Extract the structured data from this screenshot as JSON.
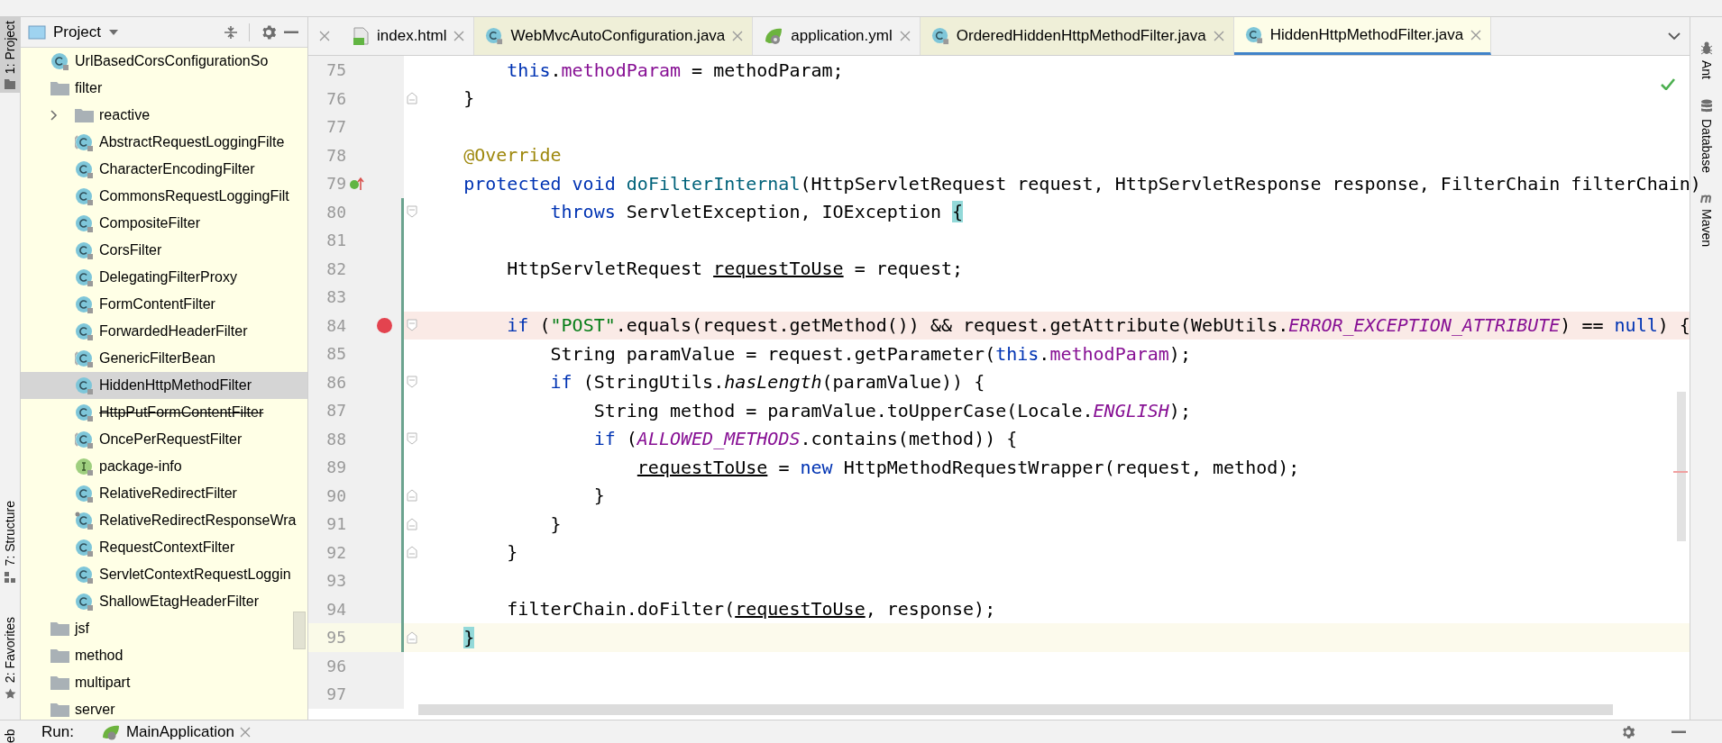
{
  "left_tool_strip": [
    {
      "label": "1: Project",
      "kind": "folder",
      "selected": true
    },
    {
      "label": "7: Structure",
      "kind": "structure",
      "selected": false
    },
    {
      "label": "2: Favorites",
      "kind": "favorites",
      "selected": false
    }
  ],
  "project": {
    "title": "Project",
    "tree": [
      {
        "label": "UrlBasedCorsConfigurationSo",
        "kind": "class",
        "selected": false,
        "deprecated": false
      },
      {
        "label": "filter",
        "kind": "folder",
        "selected": false,
        "deprecated": false,
        "children": [
          {
            "label": "reactive",
            "kind": "folder",
            "selected": false,
            "deprecated": false,
            "expanded": false
          },
          {
            "label": "AbstractRequestLoggingFilte",
            "kind": "abstract_class",
            "selected": false,
            "deprecated": false
          },
          {
            "label": "CharacterEncodingFilter",
            "kind": "class",
            "selected": false,
            "deprecated": false
          },
          {
            "label": "CommonsRequestLoggingFilt",
            "kind": "class",
            "selected": false,
            "deprecated": false
          },
          {
            "label": "CompositeFilter",
            "kind": "class",
            "selected": false,
            "deprecated": false
          },
          {
            "label": "CorsFilter",
            "kind": "class",
            "selected": false,
            "deprecated": false
          },
          {
            "label": "DelegatingFilterProxy",
            "kind": "class",
            "selected": false,
            "deprecated": false
          },
          {
            "label": "FormContentFilter",
            "kind": "class",
            "selected": false,
            "deprecated": false
          },
          {
            "label": "ForwardedHeaderFilter",
            "kind": "class",
            "selected": false,
            "deprecated": false
          },
          {
            "label": "GenericFilterBean",
            "kind": "abstract_class",
            "selected": false,
            "deprecated": false
          },
          {
            "label": "HiddenHttpMethodFilter",
            "kind": "class",
            "selected": true,
            "deprecated": false
          },
          {
            "label": "HttpPutFormContentFilter",
            "kind": "class",
            "selected": false,
            "deprecated": true
          },
          {
            "label": "OncePerRequestFilter",
            "kind": "abstract_class",
            "selected": false,
            "deprecated": false
          },
          {
            "label": "package-info",
            "kind": "info",
            "selected": false,
            "deprecated": false
          },
          {
            "label": "RelativeRedirectFilter",
            "kind": "class",
            "selected": false,
            "deprecated": false
          },
          {
            "label": "RelativeRedirectResponseWra",
            "kind": "inner_class",
            "selected": false,
            "deprecated": false
          },
          {
            "label": "RequestContextFilter",
            "kind": "class",
            "selected": false,
            "deprecated": false
          },
          {
            "label": "ServletContextRequestLoggin",
            "kind": "class",
            "selected": false,
            "deprecated": false
          },
          {
            "label": "ShallowEtagHeaderFilter",
            "kind": "class",
            "selected": false,
            "deprecated": false
          }
        ]
      },
      {
        "label": "jsf",
        "kind": "folder",
        "selected": false,
        "deprecated": false
      },
      {
        "label": "method",
        "kind": "folder",
        "selected": false,
        "deprecated": false
      },
      {
        "label": "multipart",
        "kind": "folder",
        "selected": false,
        "deprecated": false
      },
      {
        "label": "server",
        "kind": "folder",
        "selected": false,
        "deprecated": false
      }
    ]
  },
  "tabs": [
    {
      "label": "index.html",
      "kind": "html",
      "library": false,
      "selected": false
    },
    {
      "label": "WebMvcAutoConfiguration.java",
      "kind": "class",
      "library": true,
      "selected": false
    },
    {
      "label": "application.yml",
      "kind": "spring",
      "library": false,
      "selected": false
    },
    {
      "label": "OrderedHiddenHttpMethodFilter.java",
      "kind": "class",
      "library": true,
      "selected": false
    },
    {
      "label": "HiddenHttpMethodFilter.java",
      "kind": "class",
      "library": true,
      "selected": true
    }
  ],
  "editor": {
    "lines": [
      {
        "number": "75",
        "kind": "plain",
        "breakpoint": false,
        "changed": false,
        "current": false,
        "tokens": [
          {
            "text": "        this",
            "kind": "keyword"
          },
          {
            "text": ".",
            "kind": "plain"
          },
          {
            "text": "methodParam",
            "kind": "field"
          },
          {
            "text": " = methodParam;",
            "kind": "plain"
          }
        ]
      },
      {
        "number": "76",
        "kind": "fold_end",
        "breakpoint": false,
        "changed": false,
        "current": false,
        "tokens": [
          {
            "text": "    }",
            "kind": "plain"
          }
        ]
      },
      {
        "number": "77",
        "kind": "plain",
        "breakpoint": false,
        "changed": false,
        "current": false
      },
      {
        "number": "78",
        "kind": "plain",
        "breakpoint": false,
        "changed": false,
        "current": false,
        "tokens": [
          {
            "text": "    @Override",
            "kind": "annotation"
          }
        ]
      },
      {
        "number": "79",
        "kind": "overriding",
        "breakpoint": false,
        "changed": false,
        "current": false,
        "tokens": [
          {
            "text": "    protected void ",
            "kind": "keyword"
          },
          {
            "text": "doFilterInternal",
            "kind": "method"
          },
          {
            "text": "(HttpServletRequest request, HttpServletResponse response, FilterChain filterChain)",
            "kind": "plain"
          }
        ]
      },
      {
        "number": "80",
        "kind": "fold_start",
        "breakpoint": false,
        "changed": true,
        "current": false,
        "tokens": [
          {
            "text": "            throws",
            "kind": "keyword"
          },
          {
            "text": " ServletException, IOException ",
            "kind": "plain"
          },
          {
            "text": "{",
            "kind": "brace_match"
          }
        ]
      },
      {
        "number": "81",
        "kind": "plain",
        "breakpoint": false,
        "changed": true,
        "current": false
      },
      {
        "number": "82",
        "kind": "plain",
        "breakpoint": false,
        "changed": true,
        "current": false,
        "tokens": [
          {
            "text": "        HttpServletRequest ",
            "kind": "plain"
          },
          {
            "text": "requestToUse",
            "kind": "reassigned"
          },
          {
            "text": " = request;",
            "kind": "plain"
          }
        ]
      },
      {
        "number": "83",
        "kind": "plain",
        "breakpoint": false,
        "changed": true,
        "current": false
      },
      {
        "number": "84",
        "kind": "fold_start",
        "breakpoint": true,
        "changed": true,
        "current": false,
        "tokens": [
          {
            "text": "        if",
            "kind": "keyword"
          },
          {
            "text": " (",
            "kind": "plain"
          },
          {
            "text": "\"POST\"",
            "kind": "string"
          },
          {
            "text": ".equals(request.getMethod()) && request.getAttribute(WebUtils.",
            "kind": "plain"
          },
          {
            "text": "ERROR_EXCEPTION_ATTRIBUTE",
            "kind": "constant"
          },
          {
            "text": ") == ",
            "kind": "plain"
          },
          {
            "text": "null",
            "kind": "keyword"
          },
          {
            "text": ") {",
            "kind": "plain"
          }
        ]
      },
      {
        "number": "85",
        "kind": "plain",
        "breakpoint": false,
        "changed": true,
        "current": false,
        "tokens": [
          {
            "text": "            String paramValue = request.getParameter(",
            "kind": "plain"
          },
          {
            "text": "this",
            "kind": "keyword"
          },
          {
            "text": ".",
            "kind": "plain"
          },
          {
            "text": "methodParam",
            "kind": "field"
          },
          {
            "text": ");",
            "kind": "plain"
          }
        ]
      },
      {
        "number": "86",
        "kind": "fold_start",
        "breakpoint": false,
        "changed": true,
        "current": false,
        "tokens": [
          {
            "text": "            if",
            "kind": "keyword"
          },
          {
            "text": " (StringUtils.",
            "kind": "plain"
          },
          {
            "text": "hasLength",
            "kind": "static_method"
          },
          {
            "text": "(paramValue)) {",
            "kind": "plain"
          }
        ]
      },
      {
        "number": "87",
        "kind": "plain",
        "breakpoint": false,
        "changed": true,
        "current": false,
        "tokens": [
          {
            "text": "                String method = paramValue.toUpperCase(Locale.",
            "kind": "plain"
          },
          {
            "text": "ENGLISH",
            "kind": "constant"
          },
          {
            "text": ");",
            "kind": "plain"
          }
        ]
      },
      {
        "number": "88",
        "kind": "fold_start",
        "breakpoint": false,
        "changed": true,
        "current": false,
        "tokens": [
          {
            "text": "                if",
            "kind": "keyword"
          },
          {
            "text": " (",
            "kind": "plain"
          },
          {
            "text": "ALLOWED_METHODS",
            "kind": "constant"
          },
          {
            "text": ".contains(method)) {",
            "kind": "plain"
          }
        ]
      },
      {
        "number": "89",
        "kind": "plain",
        "breakpoint": false,
        "changed": true,
        "current": false,
        "tokens": [
          {
            "text": "                    requestToUse",
            "kind": "reassigned"
          },
          {
            "text": " = ",
            "kind": "plain"
          },
          {
            "text": "new",
            "kind": "keyword"
          },
          {
            "text": " HttpMethodRequestWrapper(request, method);",
            "kind": "plain"
          }
        ]
      },
      {
        "number": "90",
        "kind": "fold_end",
        "breakpoint": false,
        "changed": true,
        "current": false,
        "tokens": [
          {
            "text": "                }",
            "kind": "plain"
          }
        ]
      },
      {
        "number": "91",
        "kind": "fold_end",
        "breakpoint": false,
        "changed": true,
        "current": false,
        "tokens": [
          {
            "text": "            }",
            "kind": "plain"
          }
        ]
      },
      {
        "number": "92",
        "kind": "fold_end",
        "breakpoint": false,
        "changed": true,
        "current": false,
        "tokens": [
          {
            "text": "        }",
            "kind": "plain"
          }
        ]
      },
      {
        "number": "93",
        "kind": "plain",
        "breakpoint": false,
        "changed": true,
        "current": false
      },
      {
        "number": "94",
        "kind": "plain",
        "breakpoint": false,
        "changed": true,
        "current": false,
        "tokens": [
          {
            "text": "        filterChain.doFilter(",
            "kind": "plain"
          },
          {
            "text": "requestToUse",
            "kind": "reassigned"
          },
          {
            "text": ", response);",
            "kind": "plain"
          }
        ]
      },
      {
        "number": "95",
        "kind": "fold_end",
        "breakpoint": false,
        "changed": true,
        "current": true,
        "tokens": [
          {
            "text": "    }",
            "kind": "brace_match"
          }
        ]
      },
      {
        "number": "96",
        "kind": "plain",
        "breakpoint": false,
        "changed": false,
        "current": false
      },
      {
        "number": "97",
        "kind": "plain",
        "breakpoint": false,
        "changed": false,
        "current": false
      }
    ]
  },
  "right_tool_strip": [
    {
      "label": "Ant",
      "kind": "ant"
    },
    {
      "label": "Database",
      "kind": "database"
    },
    {
      "label": "Maven",
      "kind": "maven"
    }
  ],
  "run_bar": {
    "label": "Run:",
    "config": "MainApplication"
  },
  "bottom_strip_label": "eb"
}
